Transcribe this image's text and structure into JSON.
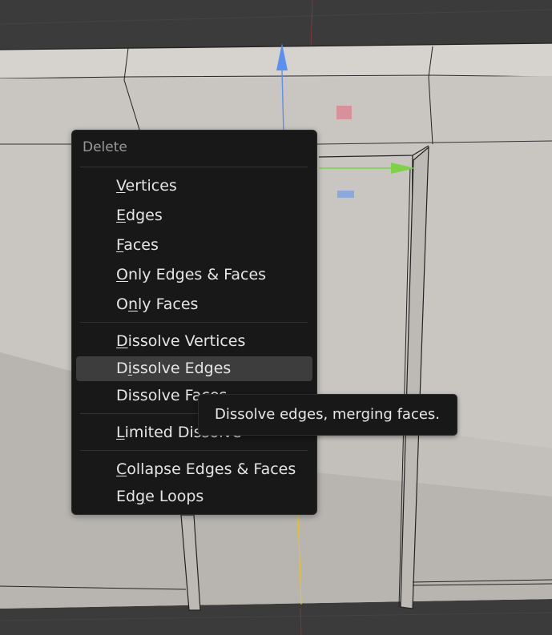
{
  "menu": {
    "title": "Delete",
    "groups": [
      [
        {
          "pre": "",
          "key": "V",
          "post": "ertices"
        },
        {
          "pre": "",
          "key": "E",
          "post": "dges"
        },
        {
          "pre": "",
          "key": "F",
          "post": "aces"
        },
        {
          "pre": "",
          "key": "O",
          "post": "nly Edges & Faces"
        },
        {
          "pre": "O",
          "key": "n",
          "post": "ly Faces"
        }
      ],
      [
        {
          "pre": "",
          "key": "D",
          "post": "issolve Vertices"
        },
        {
          "pre": "D",
          "key": "i",
          "post": "ssolve Edges"
        },
        {
          "pre": "Dissolve Fa",
          "key": "",
          "post": "ces"
        }
      ],
      [
        {
          "pre": "",
          "key": "L",
          "post": "imited Dissolve"
        }
      ],
      [
        {
          "pre": "",
          "key": "C",
          "post": "ollapse Edges & Faces"
        },
        {
          "pre": "Ed",
          "key": "g",
          "post": "e Loops"
        }
      ]
    ],
    "active_item": "Dissolve Edges"
  },
  "tooltip": {
    "text": "Dissolve edges, merging faces."
  },
  "colors": {
    "menu_bg": "#181818",
    "highlight": "#3d3d3d",
    "x_axis": "#e0667a",
    "y_axis": "#7fd14a",
    "z_axis": "#5b8ff0"
  }
}
